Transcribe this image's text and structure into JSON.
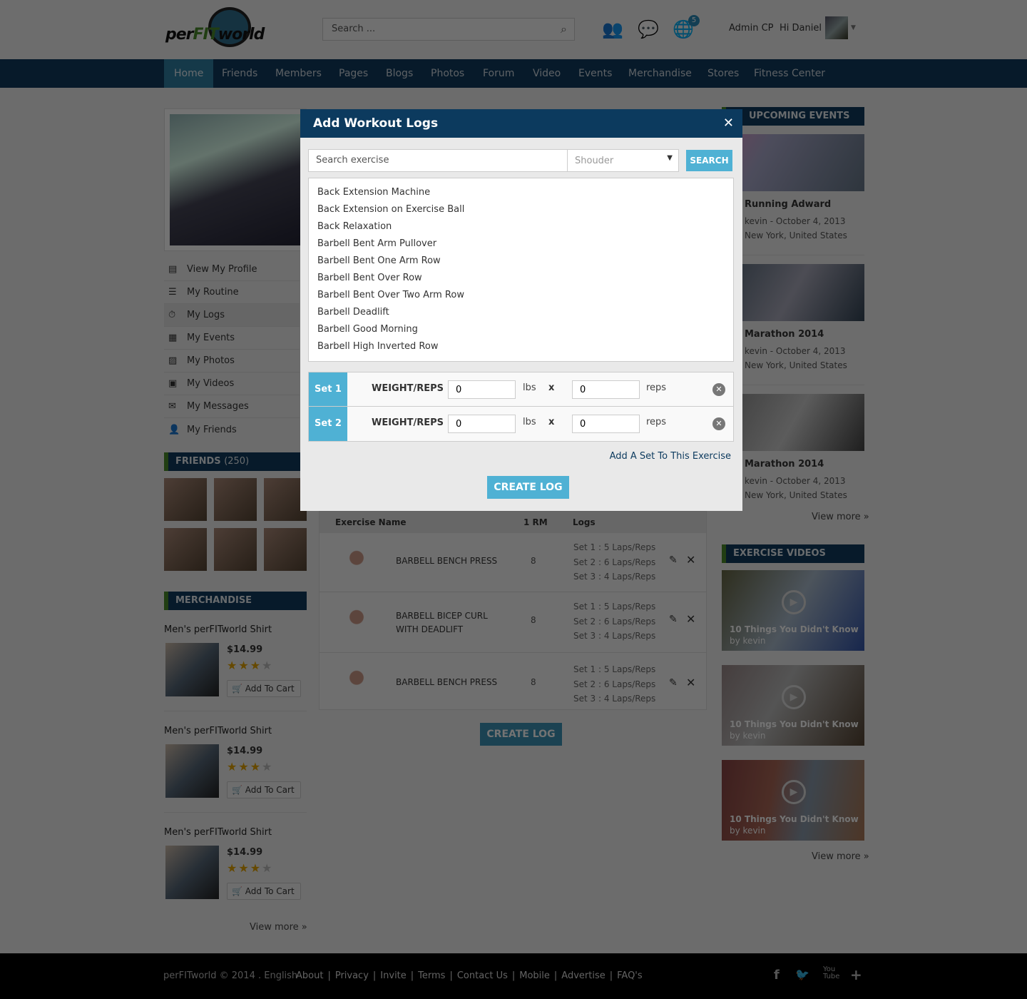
{
  "header": {
    "logo_text": "perFITworld",
    "search_placeholder": "Search ...",
    "notification_count": "5",
    "admin_link": "Admin CP",
    "greeting": "Hi Daniel"
  },
  "nav": [
    "Home",
    "Friends",
    "Members",
    "Pages",
    "Blogs",
    "Photos",
    "Forum",
    "Video",
    "Events",
    "Merchandise",
    "Stores",
    "Fitness Center"
  ],
  "sidebar": {
    "menu": [
      "View My Profile",
      "My Routine",
      "My Logs",
      "My Events",
      "My Photos",
      "My Videos",
      "My Messages",
      "My Friends"
    ],
    "friends_title": "FRIENDS",
    "friends_count": "(250)",
    "merch_title": "MERCHANDISE",
    "merch": [
      {
        "name": "Men's perFITworld Shirt",
        "price": "$14.99",
        "rating": 3,
        "cart": "Add To Cart"
      },
      {
        "name": "Men's perFITworld Shirt",
        "price": "$14.99",
        "rating": 3,
        "cart": "Add To Cart"
      },
      {
        "name": "Men's perFITworld Shirt",
        "price": "$14.99",
        "rating": 3,
        "cart": "Add To Cart"
      }
    ],
    "view_more": "View more"
  },
  "logs_table": {
    "headers": [
      "Exercise Name",
      "1 RM",
      "Logs"
    ],
    "rows": [
      {
        "name": "BARBELL BENCH PRESS",
        "rm": "8",
        "logs": [
          "Set 1 : 5 Laps/Reps",
          "Set 2 : 6 Laps/Reps",
          "Set 3 : 4 Laps/Reps"
        ]
      },
      {
        "name": "BARBELL BICEP CURL WITH DEADLIFT",
        "rm": "8",
        "logs": [
          "Set 1 : 5 Laps/Reps",
          "Set 2 : 6 Laps/Reps",
          "Set 3 : 4 Laps/Reps"
        ]
      },
      {
        "name": "BARBELL BENCH PRESS",
        "rm": "8",
        "logs": [
          "Set 1 : 5 Laps/Reps",
          "Set 2 : 6 Laps/Reps",
          "Set 3 : 4 Laps/Reps"
        ]
      }
    ],
    "create_label": "CREATE LOG"
  },
  "right": {
    "events_title": "UPCOMING EVENTS",
    "events": [
      {
        "title": "Running Adward",
        "meta": "kevin  - October 4, 2013",
        "location": "New York, United States"
      },
      {
        "title": "Marathon 2014",
        "meta": "kevin  - October 4, 2013",
        "location": "New York, United States"
      },
      {
        "title": "Marathon 2014",
        "meta": "kevin  - October 4, 2013",
        "location": "New York, United States"
      }
    ],
    "view_more": "View more",
    "videos_title": "EXERCISE VIDEOS",
    "videos": [
      {
        "title": "10 Things You Didn't Know",
        "by": "by kevin"
      },
      {
        "title": "10 Things You Didn't Know",
        "by": "by kevin"
      },
      {
        "title": "10 Things You Didn't Know",
        "by": "by kevin"
      }
    ]
  },
  "footer": {
    "copyright": "perFITworld © 2014 . English",
    "links": [
      "About",
      "Privacy",
      "Invite",
      "Terms",
      "Contact Us",
      "Mobile",
      "Advertise",
      "FAQ's"
    ]
  },
  "modal": {
    "title": "Add Workout Logs",
    "search_placeholder": "Search exercise",
    "category": "Shouder",
    "search_label": "SEARCH",
    "exercises": [
      "Back Extension Machine",
      "Back Extension on Exercise Ball",
      "Back Relaxation",
      "Barbell Bent Arm Pullover",
      "Barbell Bent One Arm Row",
      "Barbell Bent Over Row",
      "Barbell Bent Over Two Arm Row",
      "Barbell Deadlift",
      "Barbell Good Morning",
      "Barbell High Inverted Row"
    ],
    "sets": [
      {
        "label": "Set 1",
        "field_label": "WEIGHT/REPS",
        "weight": "0",
        "weight_unit": "lbs",
        "times": "x",
        "reps": "0",
        "reps_unit": "reps"
      },
      {
        "label": "Set 2",
        "field_label": "WEIGHT/REPS",
        "weight": "0",
        "weight_unit": "lbs",
        "times": "x",
        "reps": "0",
        "reps_unit": "reps"
      }
    ],
    "add_set_label": "Add A Set To This Exercise",
    "create_label": "CREATE LOG"
  },
  "colors": {
    "primary": "#0c3a5e",
    "accent": "#4fb1d4",
    "section_stripe": "#4a8a2a",
    "star": "#e3a300"
  }
}
